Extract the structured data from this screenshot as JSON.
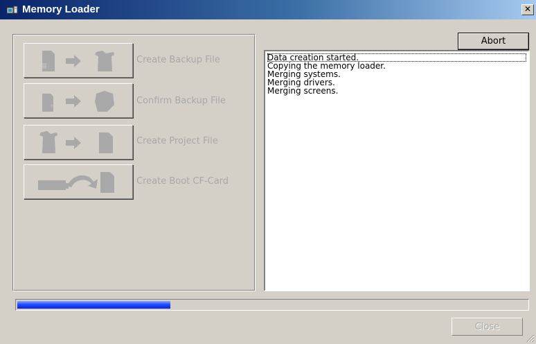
{
  "window": {
    "title": "Memory Loader",
    "title_icon": "memory-loader-app-icon",
    "close_glyph": "✕"
  },
  "actions": [
    {
      "label": "Create Backup File",
      "icon": "card-to-device-icon",
      "enabled": false
    },
    {
      "label": "Confirm Backup File",
      "icon": "compare-backup-icon",
      "enabled": false
    },
    {
      "label": "Create Project File",
      "icon": "device-to-card-icon",
      "enabled": false
    },
    {
      "label": "Create Boot CF-Card",
      "icon": "boot-card-icon",
      "enabled": false
    }
  ],
  "abort_label": "Abort",
  "log": {
    "lines": [
      "Data creation started.",
      "Copying the memory loader.",
      "Merging systems.",
      "Merging drivers.",
      "Merging screens."
    ]
  },
  "progress": {
    "fraction": 0.3
  },
  "close_label": "Close",
  "colors": {
    "titlebar_start": "#0a246a",
    "titlebar_end": "#a6caf0",
    "window_face": "#d4d0c8",
    "progress_fill": "#1f4fff",
    "disabled_text": "#a8a8a8"
  }
}
